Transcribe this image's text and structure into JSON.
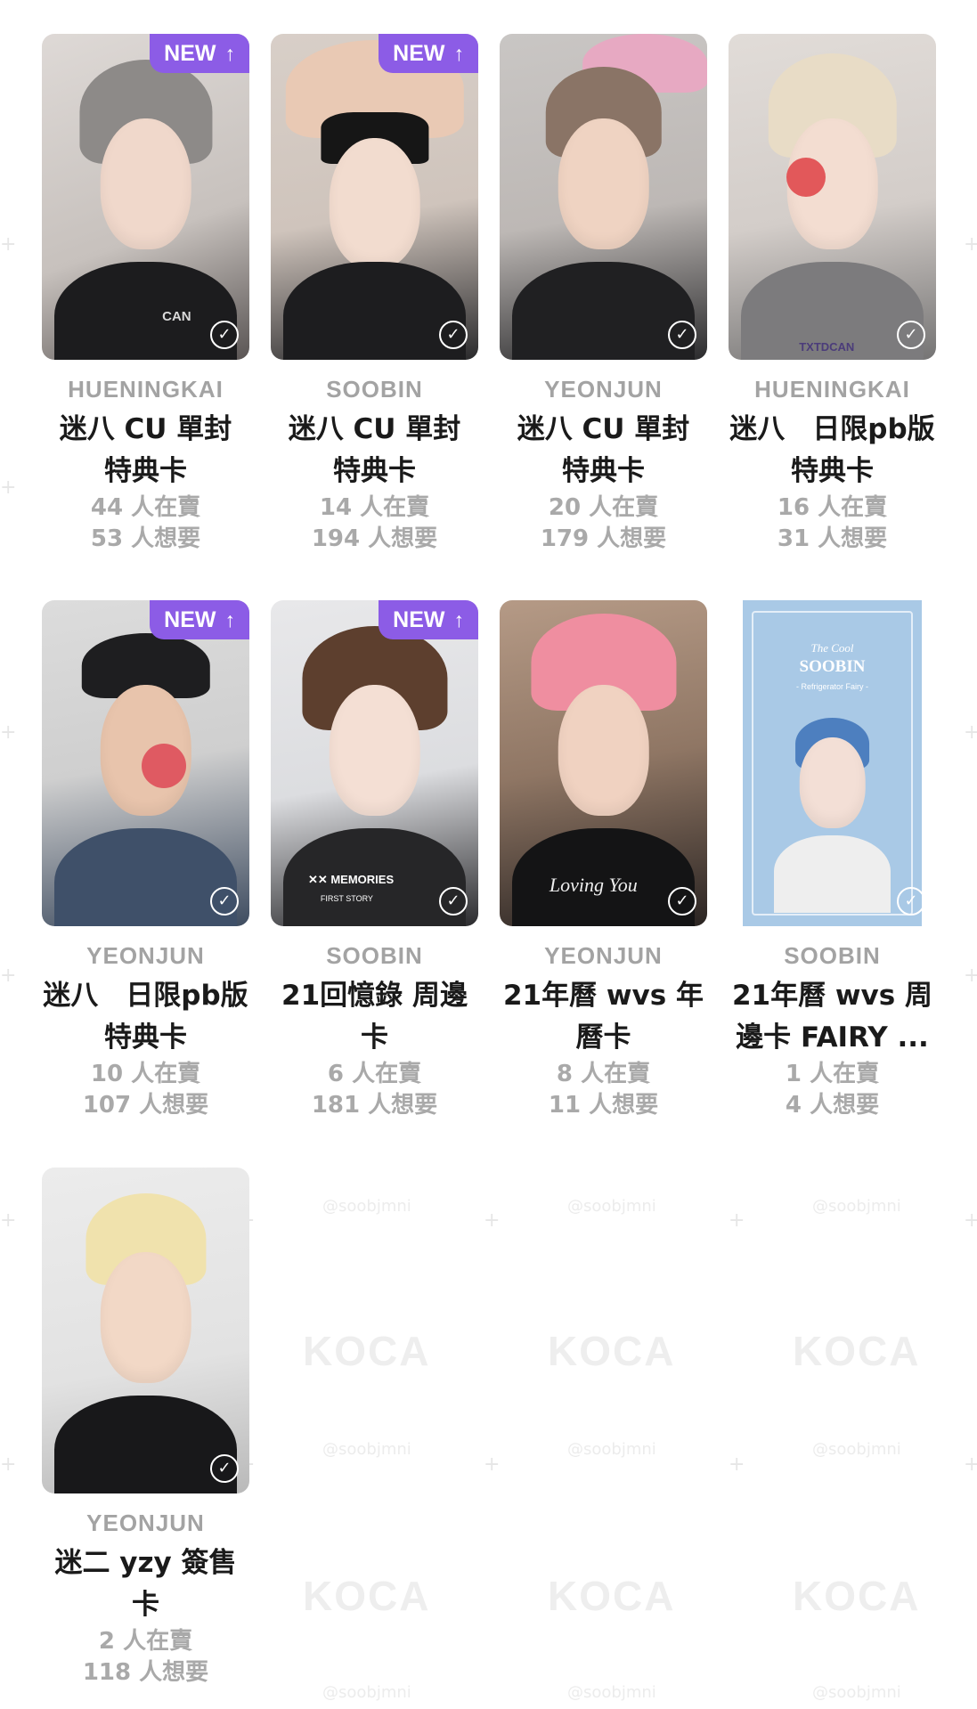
{
  "watermarks": {
    "logo": "KOCA",
    "handle": "@soobjmni"
  },
  "badge_label": "NEW",
  "cards": [
    {
      "member": "HUENINGKAI",
      "title": "迷八 CU 單封 特典卡",
      "selling": "44 人在賣",
      "wanting": "53 人想要",
      "new": true,
      "print": "CAN"
    },
    {
      "member": "SOOBIN",
      "title": "迷八 CU 單封 特典卡",
      "selling": "14 人在賣",
      "wanting": "194 人想要",
      "new": true
    },
    {
      "member": "YEONJUN",
      "title": "迷八 CU 單封 特典卡",
      "selling": "20 人在賣",
      "wanting": "179 人想要",
      "new": false
    },
    {
      "member": "HUENINGKAI",
      "title": "迷八　日限pb版 特典卡",
      "selling": "16 人在賣",
      "wanting": "31 人想要",
      "new": false,
      "print": "TXTDCAN"
    },
    {
      "member": "YEONJUN",
      "title": "迷八　日限pb版 特典卡",
      "selling": "10 人在賣",
      "wanting": "107 人想要",
      "new": true
    },
    {
      "member": "SOOBIN",
      "title": "21回憶錄 周邊卡",
      "selling": "6 人在賣",
      "wanting": "181 人想要",
      "new": true,
      "print": "✕✕ MEMORIES",
      "print2": "FIRST STORY"
    },
    {
      "member": "YEONJUN",
      "title": "21年曆 wvs 年曆卡",
      "selling": "8 人在賣",
      "wanting": "11 人想要",
      "new": false,
      "print": "Loving You"
    },
    {
      "member": "SOOBIN",
      "title": "21年曆 wvs 周邊卡 FAIRY ...",
      "selling": "1 人在賣",
      "wanting": "4 人想要",
      "new": false,
      "print": "The Cool",
      "print2": "SOOBIN",
      "print3": "- Refrigerator Fairy -"
    },
    {
      "member": "YEONJUN",
      "title": "迷二 yzy 簽售卡",
      "selling": "2 人在賣",
      "wanting": "118 人想要",
      "new": false
    }
  ]
}
